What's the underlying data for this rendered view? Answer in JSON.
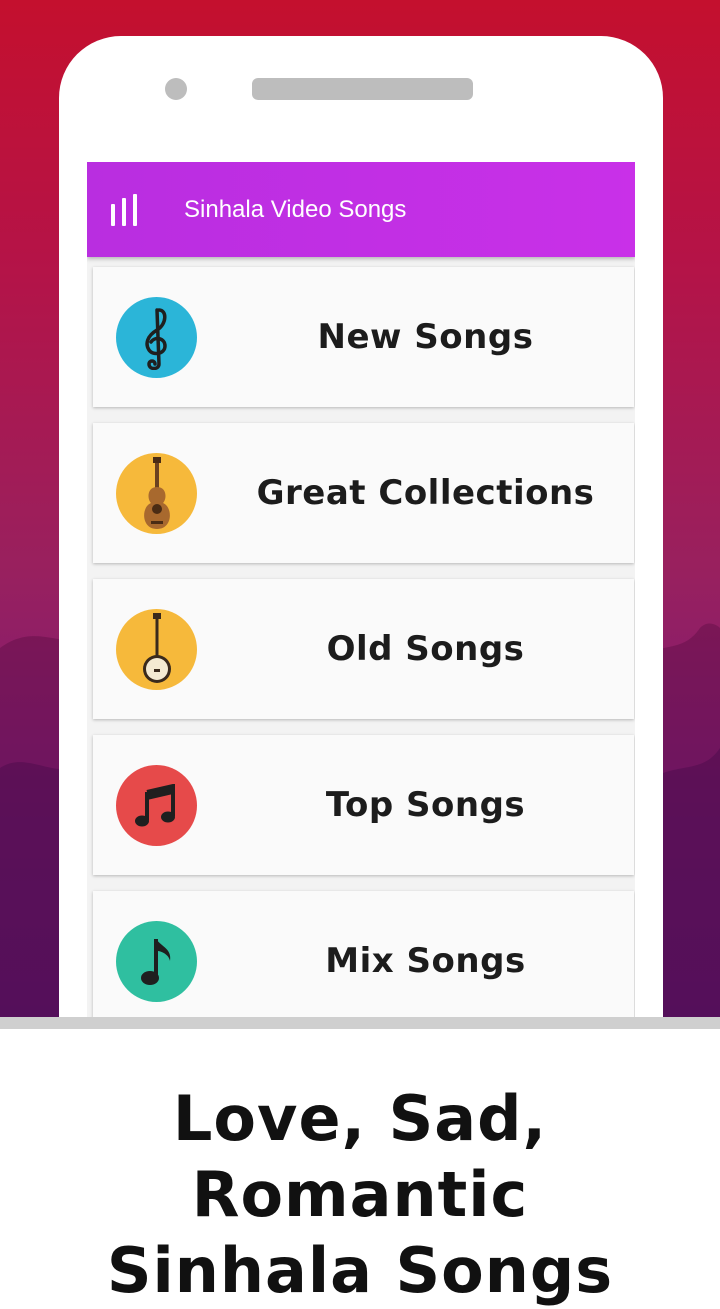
{
  "app": {
    "title": "Sinhala Video Songs",
    "header_bg_color": "#c930e8"
  },
  "categories": [
    {
      "label": "New Songs",
      "icon": "treble-clef-icon",
      "color": "#2bb5d8"
    },
    {
      "label": "Great Collections",
      "icon": "guitar-icon",
      "color": "#f6b93b"
    },
    {
      "label": "Old Songs",
      "icon": "banjo-icon",
      "color": "#f6b93b"
    },
    {
      "label": "Top Songs",
      "icon": "music-notes-icon",
      "color": "#e64a4a"
    },
    {
      "label": "Mix Songs",
      "icon": "music-note-icon",
      "color": "#2fbfa0"
    }
  ],
  "promo": {
    "line1": "Love, Sad, Romantic",
    "line2": "Sinhala Songs"
  }
}
